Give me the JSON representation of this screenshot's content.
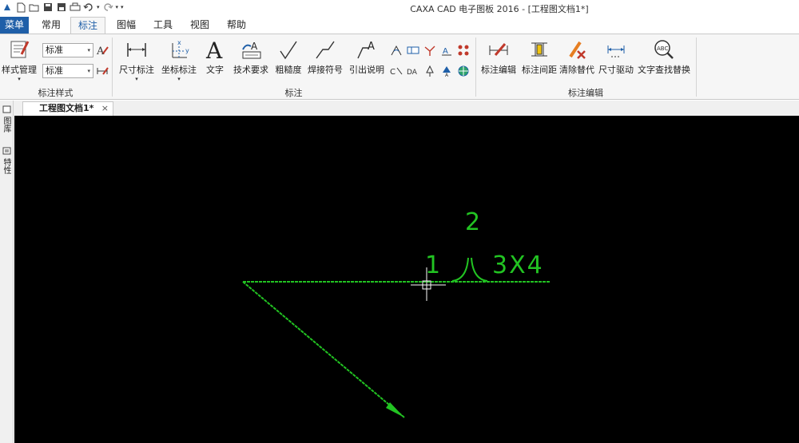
{
  "window": {
    "title": "CAXA CAD 电子图板 2016 - [工程图文档1*]"
  },
  "tabs": {
    "menu": "菜单",
    "common": "常用",
    "annotate": "标注",
    "sheet": "图幅",
    "tools": "工具",
    "view": "视图",
    "help": "帮助"
  },
  "ribbon": {
    "style_group": {
      "label": "标注样式",
      "style_manage": "样式管理",
      "combo_text_style": "标准",
      "combo_dim_style": "标准"
    },
    "annotate_group": {
      "label": "标注",
      "dim": "尺寸标注",
      "coord_dim": "坐标标注",
      "text": "文字",
      "tech_req": "技术要求",
      "roughness": "粗糙度",
      "weld": "焊接符号",
      "leader": "引出说明"
    },
    "edit_group": {
      "label": "标注编辑",
      "dim_edit": "标注编辑",
      "dim_spacing": "标注间距",
      "clear_override": "清除替代",
      "dim_drive": "尺寸驱动",
      "text_find_replace": "文字查找替换"
    }
  },
  "doc_tab": {
    "title": "工程图文档1*",
    "close": "×"
  },
  "side_tabs": {
    "library": "图库",
    "properties": "特性"
  },
  "drawing": {
    "upper_text": "2",
    "lower_text": "1",
    "weld_spec": "3X4",
    "color": "#22c322"
  },
  "icons": [
    "app-icon",
    "new-file-icon",
    "open-icon",
    "save-icon",
    "save-as-icon",
    "print-icon",
    "undo-icon",
    "redo-icon",
    "customize-icon",
    "text-style-icon",
    "dim-style-icon"
  ]
}
